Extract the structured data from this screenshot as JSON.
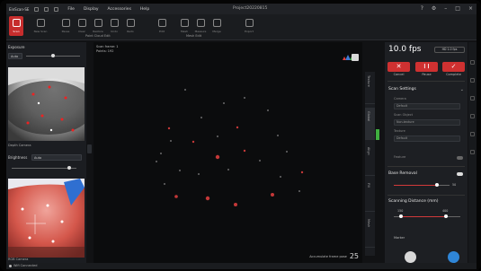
{
  "titlebar": {
    "brand": "EinScan-SE",
    "menus": [
      "File",
      "Display",
      "Accessories",
      "Help"
    ],
    "title": "Project20220815"
  },
  "toolbar": {
    "tools": [
      "Scan",
      "New Scan",
      "Pause",
      "Clear",
      "Restore",
      "Undo",
      "Redo",
      "Edit",
      "Mesh",
      "Measure",
      "Merge",
      "Export"
    ],
    "groups": [
      "Point Cloud Edit",
      "Mesh Edit"
    ]
  },
  "left": {
    "exposure_title": "Exposure",
    "exposure_mode": "Auto",
    "camera1_label": "Depth Camera",
    "brightness_title": "Brightness",
    "brightness_mode": "Auto",
    "camera2_label": "RGB Camera"
  },
  "viewport": {
    "info_line1": "Scan frame: 1",
    "info_line2": "Points: 192",
    "bottom_label": "Accumulate frame pose",
    "bottom_value": "25"
  },
  "sidetabs": [
    "Texture",
    "Global",
    "Align",
    "Fill",
    "Mesh"
  ],
  "right": {
    "fps": "10.0 fps",
    "fps_badge": "HD 1.0 fps",
    "btn_cancel": "Cancel",
    "btn_pause": "Pause",
    "btn_complete": "Complete",
    "cancel_glyph": "✕",
    "pause_glyph": "❙❙",
    "complete_glyph": "✓",
    "scan_settings": "Scan Settings",
    "fields": [
      {
        "label": "Camera",
        "value": "Default"
      },
      {
        "label": "Scan Object",
        "value": "Non-texture"
      },
      {
        "label": "Texture",
        "value": "Default"
      }
    ],
    "feature": "Feature",
    "base_removal": "Base Removal",
    "base_value": "50",
    "distance_title": "Scanning Distance (mm)",
    "distance_min": "150",
    "distance_max": "400",
    "markers": "Marker"
  },
  "statusbar": {
    "text": "Wifi Connected"
  }
}
